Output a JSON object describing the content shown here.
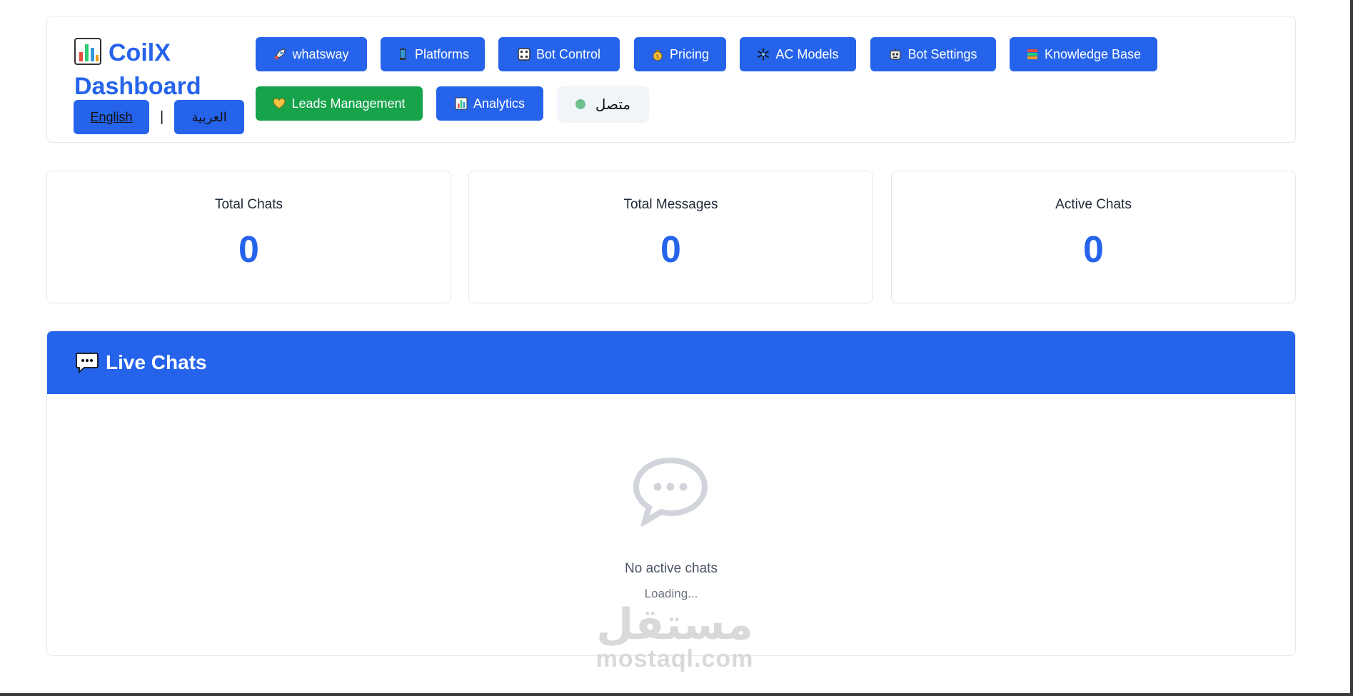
{
  "brand": {
    "title": "CoilX Dashboard"
  },
  "language": {
    "english": "English",
    "separator": "|",
    "arabic": "العربية"
  },
  "nav": [
    {
      "label": "whatsway",
      "icon": "rocket-icon"
    },
    {
      "label": "Platforms",
      "icon": "phone-icon"
    },
    {
      "label": "Bot Control",
      "icon": "dice-icon"
    },
    {
      "label": "Pricing",
      "icon": "money-bag-icon"
    },
    {
      "label": "AC Models",
      "icon": "snowflake-icon"
    },
    {
      "label": "Bot Settings",
      "icon": "robot-icon"
    },
    {
      "label": "Knowledge Base",
      "icon": "books-icon"
    },
    {
      "label": "Leads Management",
      "icon": "heart-icon",
      "color": "#16a34a"
    },
    {
      "label": "Analytics",
      "icon": "chart-icon"
    }
  ],
  "status": {
    "label": "متصل",
    "color": "#6fbf8f"
  },
  "stats": [
    {
      "label": "Total Chats",
      "value": "0"
    },
    {
      "label": "Total Messages",
      "value": "0"
    },
    {
      "label": "Active Chats",
      "value": "0"
    }
  ],
  "live_chats": {
    "title": "Live Chats",
    "icon": "speech-bubble-icon",
    "empty_icon": "chat-bubble-icon",
    "empty_text": "No active chats",
    "loading_text": "Loading..."
  },
  "watermark": {
    "arabic": "مستقل",
    "latin": "mostaql.com"
  },
  "colors": {
    "primary": "#2563eb",
    "success": "#16a34a",
    "muted": "#d1d5db"
  }
}
